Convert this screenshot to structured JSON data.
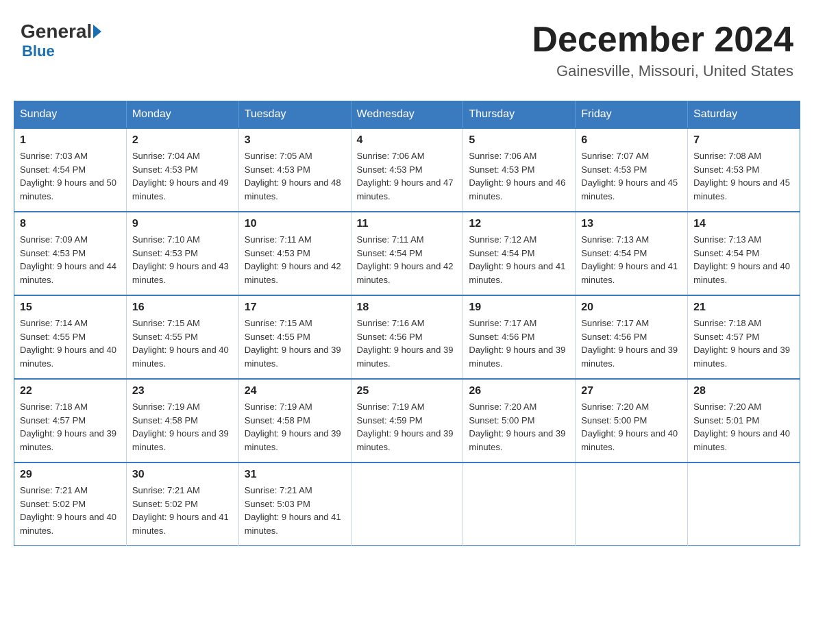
{
  "logo": {
    "general": "General",
    "blue": "Blue"
  },
  "title": "December 2024",
  "location": "Gainesville, Missouri, United States",
  "days_of_week": [
    "Sunday",
    "Monday",
    "Tuesday",
    "Wednesday",
    "Thursday",
    "Friday",
    "Saturday"
  ],
  "weeks": [
    [
      {
        "day": "1",
        "sunrise": "7:03 AM",
        "sunset": "4:54 PM",
        "daylight": "9 hours and 50 minutes."
      },
      {
        "day": "2",
        "sunrise": "7:04 AM",
        "sunset": "4:53 PM",
        "daylight": "9 hours and 49 minutes."
      },
      {
        "day": "3",
        "sunrise": "7:05 AM",
        "sunset": "4:53 PM",
        "daylight": "9 hours and 48 minutes."
      },
      {
        "day": "4",
        "sunrise": "7:06 AM",
        "sunset": "4:53 PM",
        "daylight": "9 hours and 47 minutes."
      },
      {
        "day": "5",
        "sunrise": "7:06 AM",
        "sunset": "4:53 PM",
        "daylight": "9 hours and 46 minutes."
      },
      {
        "day": "6",
        "sunrise": "7:07 AM",
        "sunset": "4:53 PM",
        "daylight": "9 hours and 45 minutes."
      },
      {
        "day": "7",
        "sunrise": "7:08 AM",
        "sunset": "4:53 PM",
        "daylight": "9 hours and 45 minutes."
      }
    ],
    [
      {
        "day": "8",
        "sunrise": "7:09 AM",
        "sunset": "4:53 PM",
        "daylight": "9 hours and 44 minutes."
      },
      {
        "day": "9",
        "sunrise": "7:10 AM",
        "sunset": "4:53 PM",
        "daylight": "9 hours and 43 minutes."
      },
      {
        "day": "10",
        "sunrise": "7:11 AM",
        "sunset": "4:53 PM",
        "daylight": "9 hours and 42 minutes."
      },
      {
        "day": "11",
        "sunrise": "7:11 AM",
        "sunset": "4:54 PM",
        "daylight": "9 hours and 42 minutes."
      },
      {
        "day": "12",
        "sunrise": "7:12 AM",
        "sunset": "4:54 PM",
        "daylight": "9 hours and 41 minutes."
      },
      {
        "day": "13",
        "sunrise": "7:13 AM",
        "sunset": "4:54 PM",
        "daylight": "9 hours and 41 minutes."
      },
      {
        "day": "14",
        "sunrise": "7:13 AM",
        "sunset": "4:54 PM",
        "daylight": "9 hours and 40 minutes."
      }
    ],
    [
      {
        "day": "15",
        "sunrise": "7:14 AM",
        "sunset": "4:55 PM",
        "daylight": "9 hours and 40 minutes."
      },
      {
        "day": "16",
        "sunrise": "7:15 AM",
        "sunset": "4:55 PM",
        "daylight": "9 hours and 40 minutes."
      },
      {
        "day": "17",
        "sunrise": "7:15 AM",
        "sunset": "4:55 PM",
        "daylight": "9 hours and 39 minutes."
      },
      {
        "day": "18",
        "sunrise": "7:16 AM",
        "sunset": "4:56 PM",
        "daylight": "9 hours and 39 minutes."
      },
      {
        "day": "19",
        "sunrise": "7:17 AM",
        "sunset": "4:56 PM",
        "daylight": "9 hours and 39 minutes."
      },
      {
        "day": "20",
        "sunrise": "7:17 AM",
        "sunset": "4:56 PM",
        "daylight": "9 hours and 39 minutes."
      },
      {
        "day": "21",
        "sunrise": "7:18 AM",
        "sunset": "4:57 PM",
        "daylight": "9 hours and 39 minutes."
      }
    ],
    [
      {
        "day": "22",
        "sunrise": "7:18 AM",
        "sunset": "4:57 PM",
        "daylight": "9 hours and 39 minutes."
      },
      {
        "day": "23",
        "sunrise": "7:19 AM",
        "sunset": "4:58 PM",
        "daylight": "9 hours and 39 minutes."
      },
      {
        "day": "24",
        "sunrise": "7:19 AM",
        "sunset": "4:58 PM",
        "daylight": "9 hours and 39 minutes."
      },
      {
        "day": "25",
        "sunrise": "7:19 AM",
        "sunset": "4:59 PM",
        "daylight": "9 hours and 39 minutes."
      },
      {
        "day": "26",
        "sunrise": "7:20 AM",
        "sunset": "5:00 PM",
        "daylight": "9 hours and 39 minutes."
      },
      {
        "day": "27",
        "sunrise": "7:20 AM",
        "sunset": "5:00 PM",
        "daylight": "9 hours and 40 minutes."
      },
      {
        "day": "28",
        "sunrise": "7:20 AM",
        "sunset": "5:01 PM",
        "daylight": "9 hours and 40 minutes."
      }
    ],
    [
      {
        "day": "29",
        "sunrise": "7:21 AM",
        "sunset": "5:02 PM",
        "daylight": "9 hours and 40 minutes."
      },
      {
        "day": "30",
        "sunrise": "7:21 AM",
        "sunset": "5:02 PM",
        "daylight": "9 hours and 41 minutes."
      },
      {
        "day": "31",
        "sunrise": "7:21 AM",
        "sunset": "5:03 PM",
        "daylight": "9 hours and 41 minutes."
      },
      null,
      null,
      null,
      null
    ]
  ]
}
